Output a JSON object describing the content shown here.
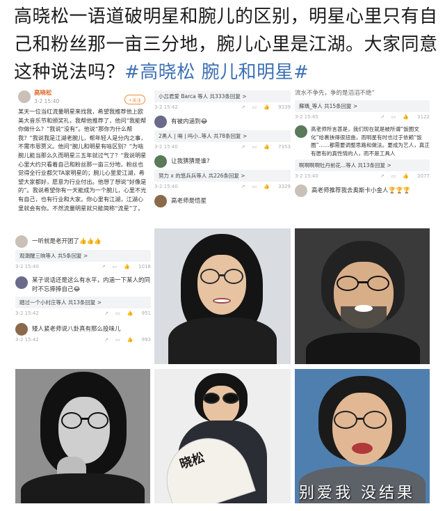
{
  "headline": {
    "text": "高晓松一语道破明星和腕儿的区别，明星心里只有自己和粉丝那一亩三分地，腕儿心里是江湖。大家同意这种说法吗？",
    "hashtag": "#高晓松 腕儿和明星#"
  },
  "post": {
    "author": "高晓松",
    "time": "3-2 15:40",
    "follow_label": "+关注",
    "body": "某天一位当红流量明星来找我，希望我推荐他上欧美大音乐节和颁奖礼，我帮他推荐了，他问“我能帮你做什么？”我说“没有”。他说“那你为什么帮我？”我说我是江湖老腕儿，帮年轻人是分内之事，不需市恩贾义。他问“腕儿和明星有啥区别？”为啥腕儿能当那么久而明星三五年就过气了？“我说明星心里大约只看着自己和粉丝那一亩三分地，粉丝也觉得全行业都欠TA家明星的；腕儿心里爱江湖，希望大家都好，愿意为行业付出。他想了想说“好像是的”。我说希望你有一天能成为一个腕儿，心里不光有自己，也有行业和大家。你心里有江湖，江湖心里就会有你。不然流量明星就只能简称“流星”了。"
  },
  "comments_mid": {
    "c1_reply": "小吕君爱 Barca 等人  共333条回复 >",
    "c1_time": "3-2 15:42",
    "c1_likes": "9339",
    "c2_text": "有被内涵到😂",
    "c2_reply": "2黑人 | 嗝 | 吗小..等人  共78条回复 >",
    "c2_time": "3-2 15:40",
    "c2_likes": "7353",
    "c3_text": "让我猜猜是谁?",
    "c3_reply": "努力 x 的悠兵兵等人  共226条回复 >",
    "c3_time": "3-2 15:40",
    "c3_likes": "3329",
    "c4_text": "高老师是悟星"
  },
  "comments_right": {
    "top_text": "流水不争先，争的是滔滔不绝”",
    "top_reply": "蘇瑀_等人  共15条回复 >",
    "top_time": "3-2 15:45",
    "top_likes": "3122",
    "long_text": "高老师所言甚是，我们现在就是被所谓“饭圈文化”给裹挟得很扭曲，而明星有时也过于依赖“饭圈”……都需要调整思路和做法。要成为艺人，真正有愿有的真性情的人，而不是工具人",
    "long_reply": "啊啊啊啊牡丹前花...等人  共13条回复 >",
    "long_time": "3-2 15:40",
    "long_likes": "2077",
    "bottom_text": "高老师推荐我去奥斯卡小金人🏆🏆🏆"
  },
  "comments_left": {
    "c1_text": "一听就是老开团了👍👍👍",
    "c1_reply": "观潮醒三晌等人  共5条回复 >",
    "c1_time": "3-2 15:40",
    "c1_likes": "1018",
    "c2_text": "某子说话还是这么有水平，内涵一下某人的同时不忘捧捧自己😂",
    "c2_reply": "踏过一个小村庄等人  共13条回复 >",
    "c2_time": "3-2 15:42",
    "c2_likes": "951",
    "c3_text": "矮人紧老师说八卦真有那么投味儿",
    "c3_time": "3-2 15:42",
    "c3_likes": "993"
  },
  "photos": {
    "fan_text": "晓松",
    "bottom_caption": "别爱我 没结果"
  }
}
